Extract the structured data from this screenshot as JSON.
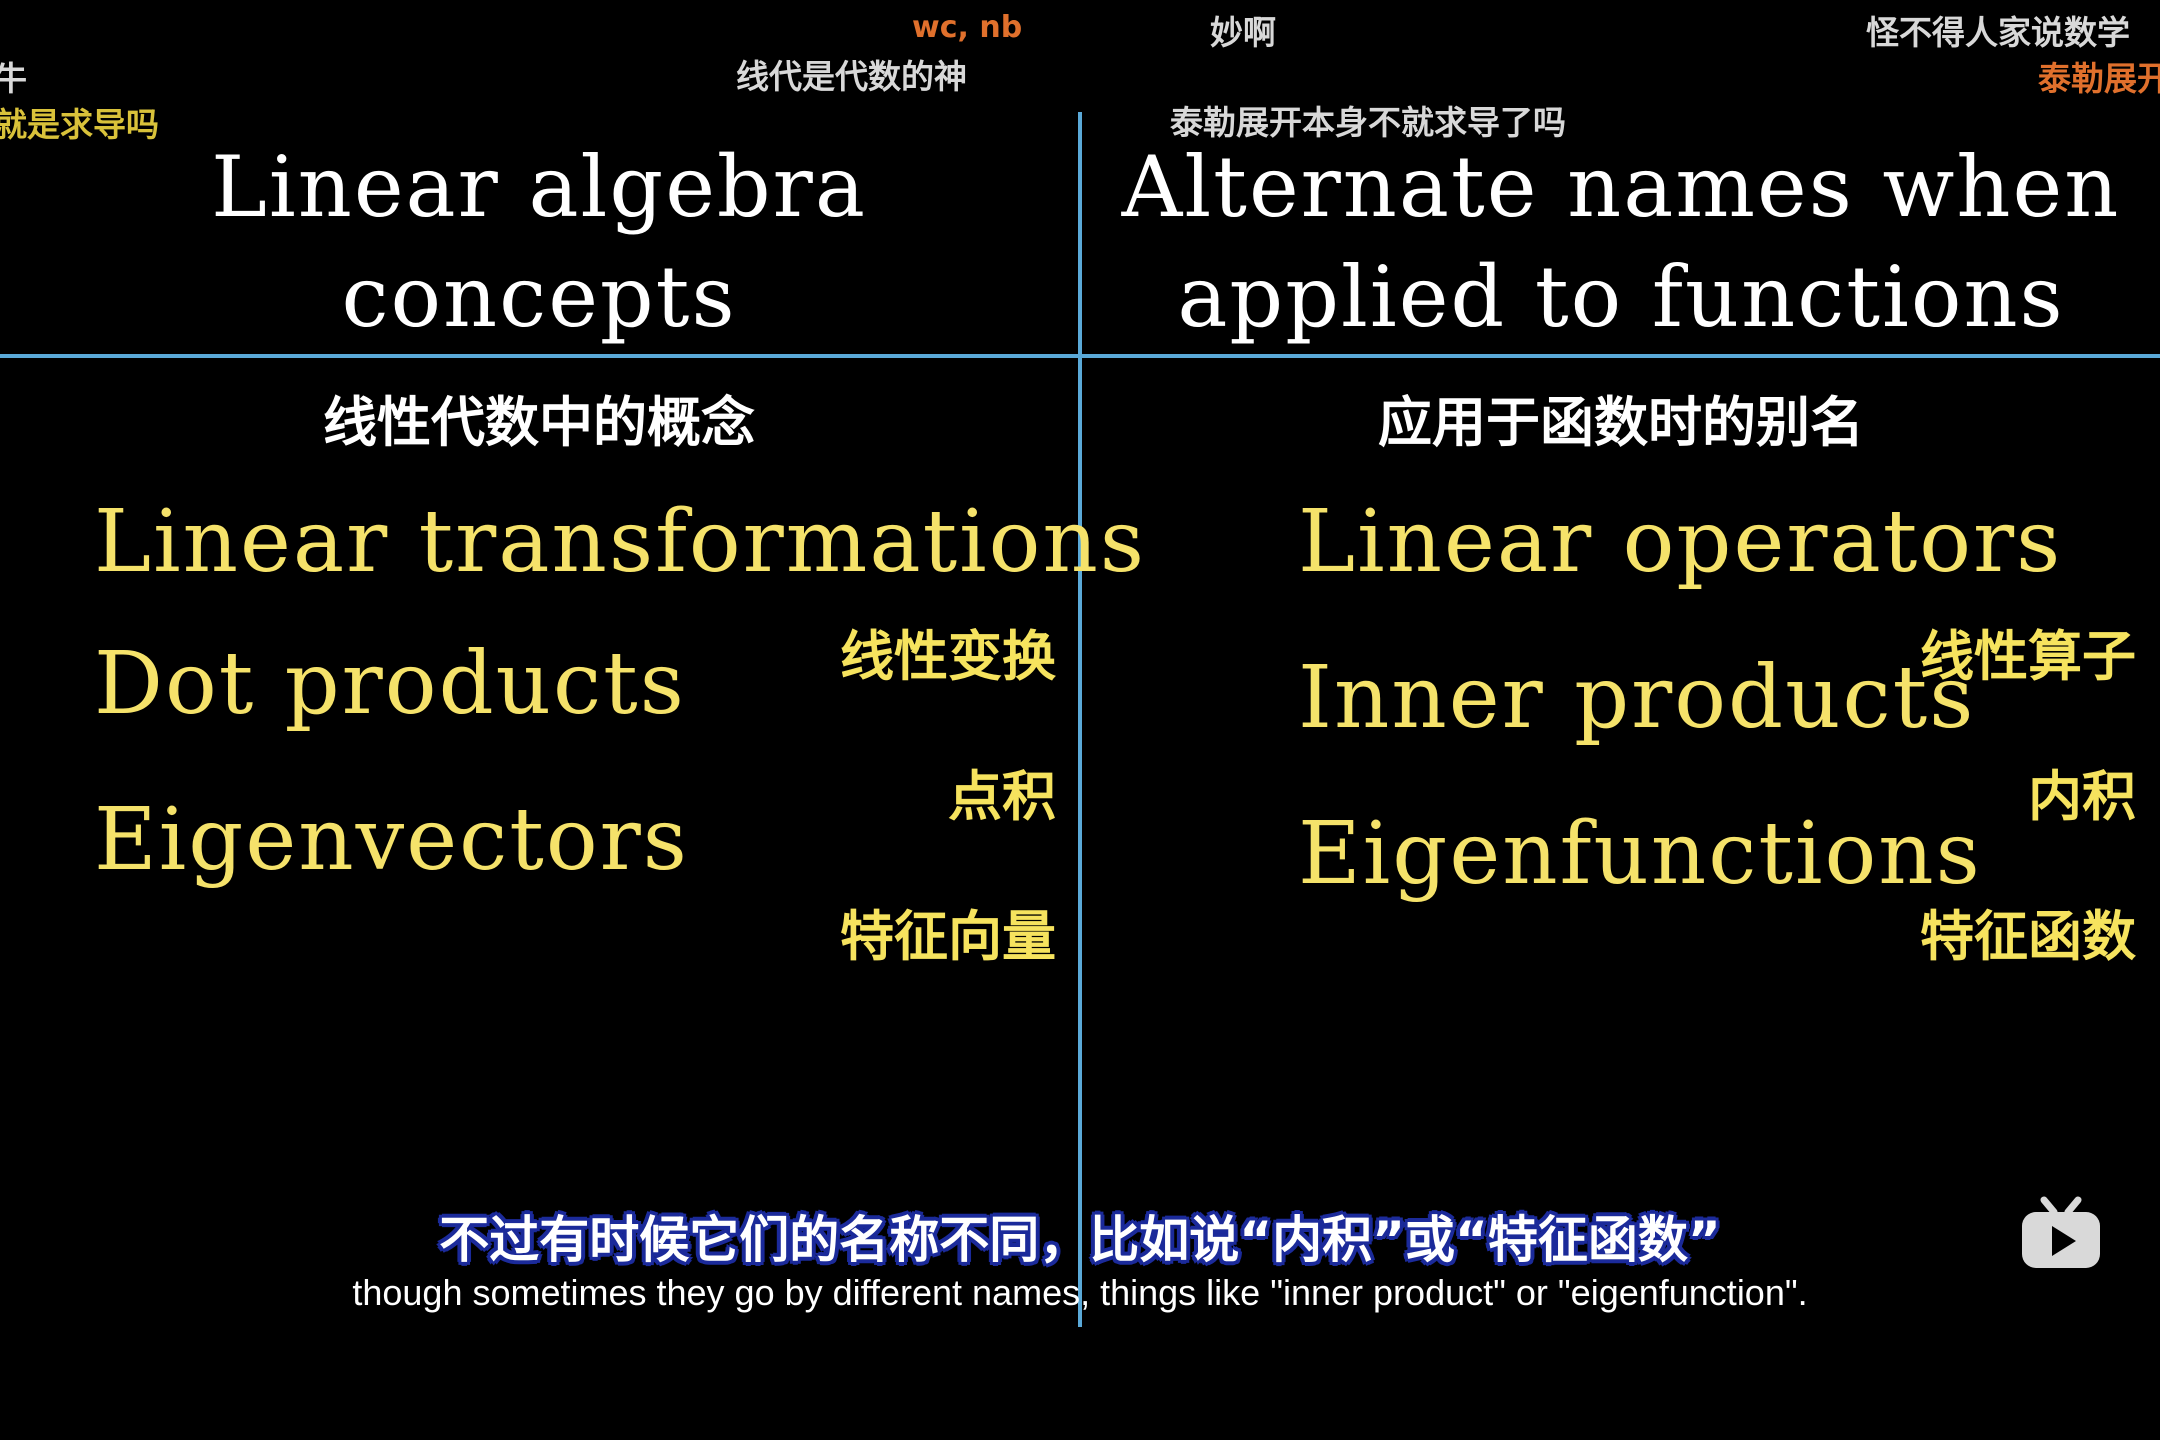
{
  "danmaku": [
    {
      "text": "wc, nb",
      "color": "#e0702c"
    },
    {
      "text": "妙啊",
      "color": "#d8d8d8"
    },
    {
      "text": "怪不得人家说数学",
      "color": "#d8d8d8"
    },
    {
      "text": "牛",
      "color": "#d8d8d8"
    },
    {
      "text": "线代是代数的神",
      "color": "#d8d8d8"
    },
    {
      "text": "泰勒展开",
      "color": "#e0702c"
    },
    {
      "text": "就是求导吗",
      "color": "#d9c23a"
    },
    {
      "text": "泰勒展开本身不就求导了吗",
      "color": "#d8d8d8"
    }
  ],
  "left": {
    "heading_line1": "Linear algebra",
    "heading_line2": "concepts",
    "heading_zh": "线性代数中的概念",
    "terms": [
      "Linear transformations",
      "Dot products",
      "Eigenvectors"
    ],
    "terms_zh": [
      "线性变换",
      "点积",
      "特征向量"
    ]
  },
  "right": {
    "heading_line1": "Alternate names when",
    "heading_line2": "applied to functions",
    "heading_zh": "应用于函数时的别名",
    "terms": [
      "Linear operators",
      "Inner products",
      "Eigenfunctions"
    ],
    "terms_zh": [
      "线性算子",
      "内积",
      "特征函数"
    ]
  },
  "subtitles": {
    "zh": "不过有时候它们的名称不同，比如说“内积”或“特征函数”",
    "en": "though sometimes they go by different names, things like \"inner product\" or \"eigenfunction\"."
  },
  "icons": {
    "tv": "bilibili-tv-icon"
  },
  "colors": {
    "divider": "#5aa9d8",
    "term": "#f5e26a",
    "background": "#000000"
  }
}
